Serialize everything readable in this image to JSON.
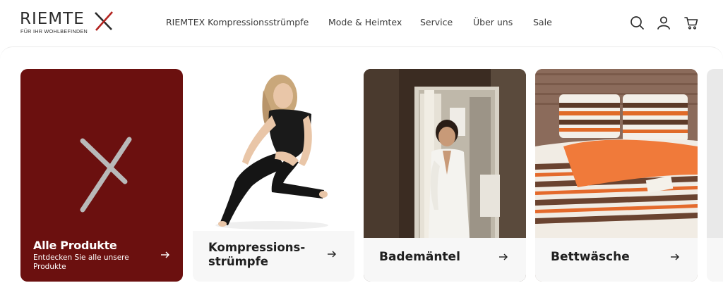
{
  "brand": {
    "name": "RIEMTEX",
    "tagline": "FÜR IHR WOHLBEFINDEN",
    "accent": "#b32420"
  },
  "nav": {
    "items": [
      {
        "label": "RIEMTEX Kompressionsstrümpfe"
      },
      {
        "label": "Mode & Heimtex"
      },
      {
        "label": "Service"
      },
      {
        "label": "Über uns"
      },
      {
        "label": "Sale"
      }
    ]
  },
  "header_icons": [
    "search-icon",
    "account-icon",
    "cart-icon"
  ],
  "cards": [
    {
      "title": "Alle Produkte",
      "subtitle": "Entdecken Sie alle unsere Produkte",
      "background": "#6b100f",
      "icon": "arrow-right-icon"
    },
    {
      "title": "Kompressions-strümpfe",
      "title_line1": "Kompressions-",
      "title_line2": "strümpfe",
      "icon": "arrow-right-icon"
    },
    {
      "title": "Bademäntel",
      "icon": "arrow-right-icon"
    },
    {
      "title": "Bettwäsche",
      "icon": "arrow-right-icon"
    }
  ]
}
